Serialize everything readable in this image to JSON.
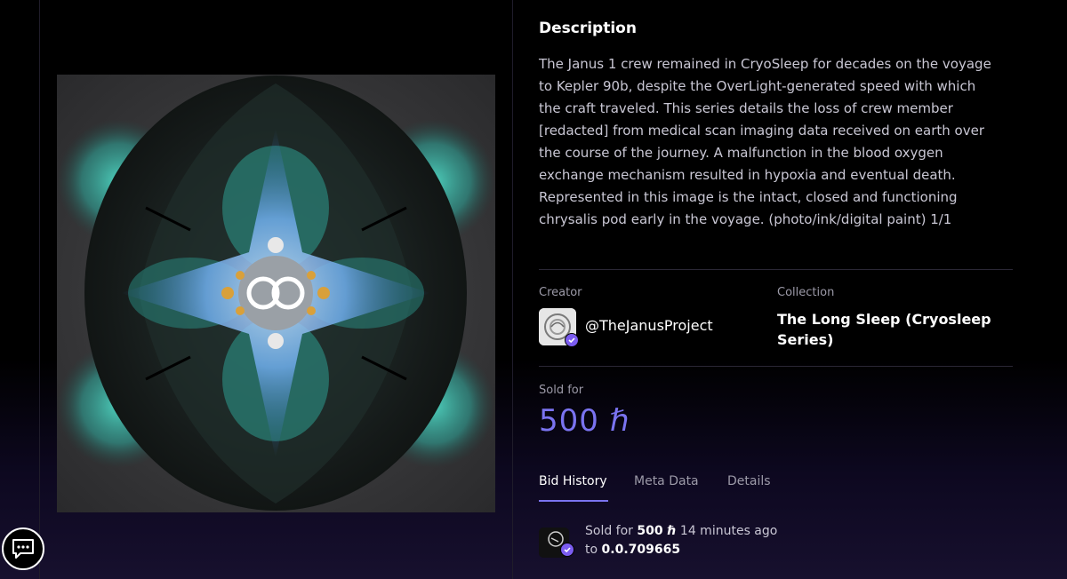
{
  "artwork": {
    "alt": "Symmetrical butterfly-wing chrysalis artwork",
    "colors": {
      "background": "#3a3a3c",
      "wing_dark": "#1b221f",
      "wing_teal": "#3fc7b5",
      "center_blue": "#6fa8e8"
    }
  },
  "chat": {
    "icon": "chat-bubble-icon"
  },
  "description": {
    "title": "Description",
    "body": "The Janus 1 crew remained in CryoSleep for decades on the voyage to Kepler 90b, despite the OverLight-generated speed with which the craft traveled. This series details the loss of crew member [redacted] from medical scan imaging data received on earth over the course of the journey. A malfunction in the blood oxygen exchange mechanism resulted in hypoxia and eventual death. Represented in this image is the intact, closed and functioning chrysalis pod early in the voyage.  (photo/ink/digital paint)  1/1"
  },
  "creator": {
    "label": "Creator",
    "handle": "@TheJanusProject",
    "verified": true
  },
  "collection": {
    "label": "Collection",
    "name": "The Long Sleep (Cryosleep Series)"
  },
  "sale": {
    "label": "Sold for",
    "price": "500 ℏ"
  },
  "tabs": [
    {
      "label": "Bid History",
      "active": true
    },
    {
      "label": "Meta Data",
      "active": false
    },
    {
      "label": "Details",
      "active": false
    }
  ],
  "bid_history": [
    {
      "prefix": "Sold for",
      "amount": "500 ℏ",
      "time": "14 minutes ago",
      "to_label": "to",
      "account": "0.0.709665"
    }
  ],
  "accent_color": "#7a73f0"
}
